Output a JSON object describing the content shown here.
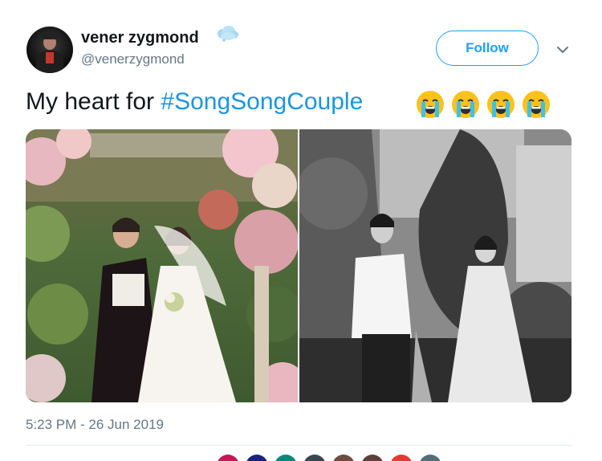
{
  "tweet": {
    "display_name": "vener zygmond",
    "handle": "@venerzygmond",
    "text_plain": "My heart for ",
    "hashtag": "#SongSongCouple",
    "emoji_icons": [
      "loudly-crying-face-icon",
      "loudly-crying-face-icon",
      "loudly-crying-face-icon",
      "loudly-crying-face-icon"
    ],
    "timestamp": "5:23 PM - 26 Jun 2019"
  },
  "actions": {
    "follow_label": "Follow"
  },
  "colors": {
    "accent": "#1da1f2",
    "hashtag": "#1b95e0",
    "muted": "#657786"
  },
  "footer": {
    "liker_avatar_colors": [
      "#c2185b",
      "#1a237e",
      "#00897b",
      "#37474f",
      "#6d4c41",
      "#5d4037",
      "#e53935",
      "#546e7a"
    ]
  }
}
